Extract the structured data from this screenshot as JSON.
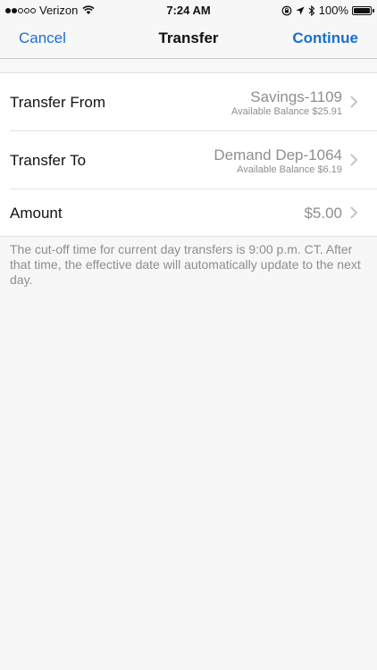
{
  "status_bar": {
    "carrier": "Verizon",
    "time": "7:24 AM",
    "battery": "100%"
  },
  "nav": {
    "cancel": "Cancel",
    "title": "Transfer",
    "continue": "Continue"
  },
  "rows": [
    {
      "label": "Transfer From",
      "value": "Savings-1109",
      "sub": "Available Balance $25.91"
    },
    {
      "label": "Transfer To",
      "value": "Demand Dep-1064",
      "sub": "Available Balance $6.19"
    },
    {
      "label": "Amount",
      "value": "$5.00"
    }
  ],
  "note": "The cut-off time for current day transfers is 9:00 p.m. CT. After that time, the effective date will automatically update to the next day.",
  "colors": {
    "accent": "#1a6fd1",
    "secondary_text": "#8e8e93",
    "background": "#f7f7f7"
  }
}
